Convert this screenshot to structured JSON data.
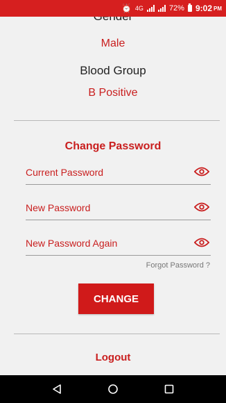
{
  "status_bar": {
    "network": "4G",
    "battery": "72%",
    "time": "9:02",
    "meridiem": "PM"
  },
  "profile": {
    "gender_label": "Gender",
    "gender_value": "Male",
    "blood_group_label": "Blood Group",
    "blood_group_value": "B Positive"
  },
  "change_password": {
    "title": "Change Password",
    "current_label": "Current Password",
    "new_label": "New Password",
    "new_again_label": "New Password Again",
    "forgot_link": "Forgot Password ?",
    "submit_label": "CHANGE"
  },
  "logout_label": "Logout",
  "colors": {
    "accent": "#c91e1e",
    "status_bar": "#d61f1f",
    "background": "#f1f1f1"
  },
  "icons": {
    "password_toggle": "eye-icon",
    "nav": [
      "back-triangle-icon",
      "home-circle-icon",
      "recents-square-icon"
    ]
  }
}
